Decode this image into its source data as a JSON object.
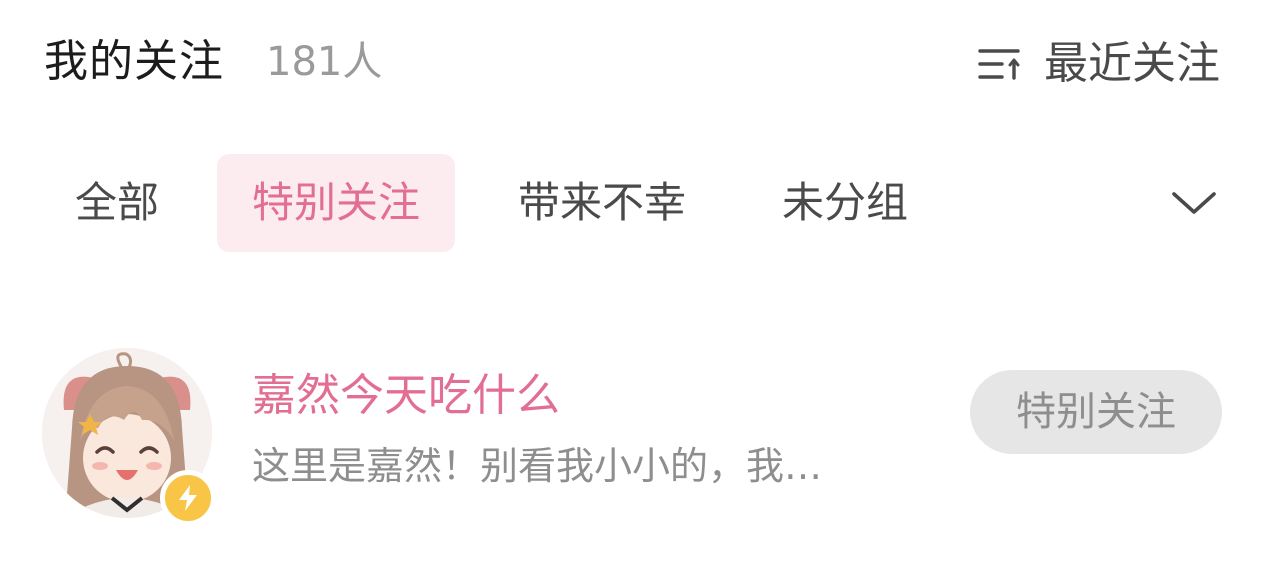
{
  "header": {
    "title": "我的关注",
    "count": "181人",
    "sort_icon": "sort-lines-icon",
    "sort_label": "最近关注"
  },
  "tabs": [
    {
      "label": "全部",
      "active": false
    },
    {
      "label": "特别关注",
      "active": true
    },
    {
      "label": "带来不幸",
      "active": false
    },
    {
      "label": "未分组",
      "active": false
    }
  ],
  "tabs_more_icon": "chevron-down-icon",
  "users": [
    {
      "name": "嘉然今天吃什么",
      "description": "这里是嘉然！别看我小小的，我…",
      "badge_icon": "lightning-icon",
      "follow_label": "特别关注"
    }
  ],
  "colors": {
    "accent": "#e26f93",
    "active_tab_bg": "#fcebef",
    "badge": "#f9c546",
    "button_bg": "#e6e6e6"
  }
}
